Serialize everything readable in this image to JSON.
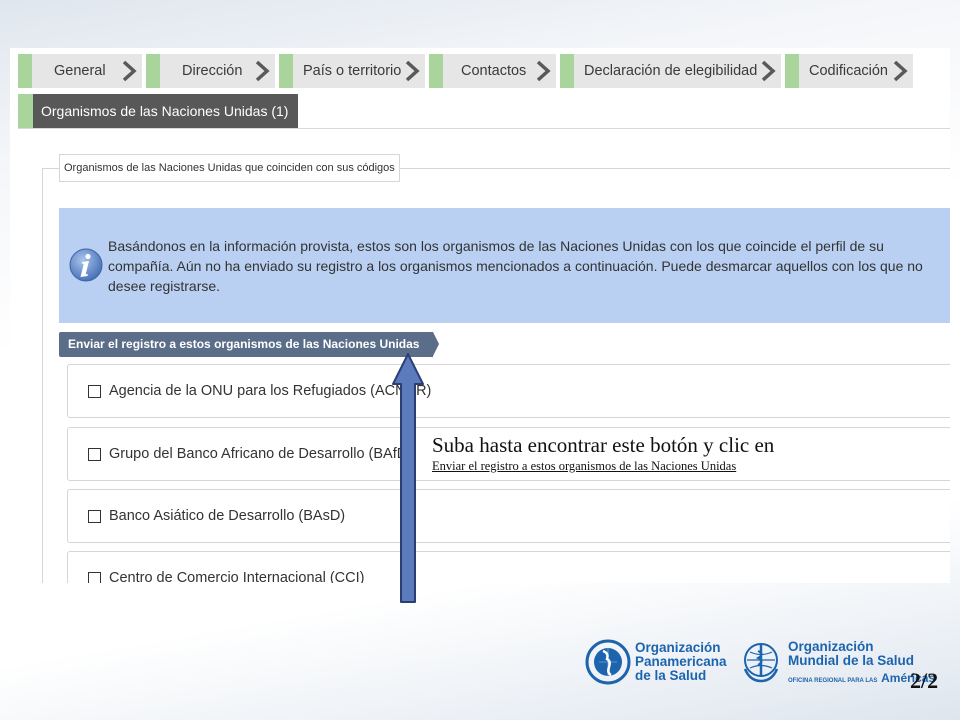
{
  "tabs": {
    "row1": [
      "General",
      "Dirección",
      "País o territorio",
      "Contactos",
      "Declaración de elegibilidad",
      "Codificación"
    ],
    "active": "Organismos de las Naciones Unidas (1)"
  },
  "section_legend": "Organismos de las Naciones Unidas que coinciden con sus códigos",
  "info": {
    "lines": [
      "Basándonos en la información provista, estos son los organismos de las Naciones Unidas con los que coincide el perfil de su",
      "compañía. Aún no ha enviado su registro a los organismos mencionados a continuación. Puede desmarcar aquellos con los que no",
      "desee registrarse."
    ]
  },
  "send_button": "Enviar el registro a estos organismos de las Naciones Unidas",
  "agencies": [
    "Agencia de la ONU para los Refugiados (ACNUR)",
    "Grupo del Banco Africano de Desarrollo (BAfD)",
    "Banco Asiático de Desarrollo (BAsD)",
    "Centro de Comercio Internacional (CCI)"
  ],
  "annotation": {
    "main": "Suba hasta encontrar este botón y clic en",
    "sub": "Enviar el registro a estos organismos de las Naciones Unidas"
  },
  "logos": {
    "paho": [
      "Organización",
      "Panamericana",
      "de la Salud"
    ],
    "who": [
      "Organización",
      "Mundial de la Salud"
    ],
    "who_sub": "OFICINA REGIONAL PARA LAS",
    "who_region": "Américas"
  },
  "page_number": "2/2",
  "colors": {
    "tab_accent": "#a9d49c",
    "active_tab": "#585858",
    "info_bg": "#b9d0f2",
    "button": "#5a6e8a",
    "brand_blue": "#1c64ad",
    "arrow": "#5b7bbd"
  }
}
